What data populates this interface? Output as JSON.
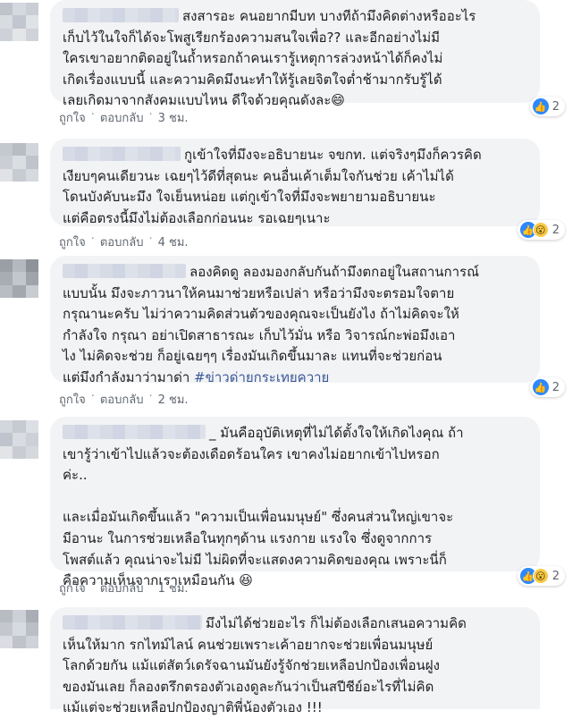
{
  "colors": {
    "bubble": "#f2f3f5",
    "like": "#2d88ff",
    "wow": "#f7c948",
    "hashtag": "#385898",
    "meta": "#606770"
  },
  "action_labels": {
    "like": "ถูกใจ",
    "reply": "ตอบกลับ",
    "dot": "·"
  },
  "comments": [
    {
      "text": "สงสารอะ คนอยากมีบท บางทีถ้ามึงคิดต่างหรืออะไร\nเก็บไว้ในใจก็ได้จะโพสูเรียกร้องความสนใจเพื่อ?? และอีกอย่างไม่มี\nใครเขาอยากติดอยู่ในถ้ำหรอกถ้าคนเรารู้เหตุการล่วงหน้าได้ก็คงไม่\nเกิดเรื่องแบบนี้ และความคิดมึงนะทำให้รู้เลยจิตใจต่ำช้ามากรับรู้ได้\nเลยเกิดมาจากสังคมแบบไหน ดีใจด้วยคุณดังละ😄",
      "time": "3 ชม.",
      "reaction_count": "2",
      "reaction_icons": [
        "like-icon"
      ]
    },
    {
      "text": "กูเข้าใจที่มึงจะอธิบายนะ จขกท. แต่จริงๆมึงก็ควรคิด\nเงียบๆคนเดียวนะ เฉยๆไว้ดีที่สุดนะ คนอื่นเค้าเต็มใจกันช่วย เค้าไม่ได้\nโดนบังคับนะมึง ใจเย็นหน่อย แต่กูเข้าใจที่มึงจะพยายามอธิบายนะ\nแต่คือตรงนี้มึงไม่ต้องเลือกก่อนนะ รอเฉยๆเนาะ",
      "time": "4 ชม.",
      "reaction_count": "2",
      "reaction_icons": [
        "like-icon",
        "wow-icon"
      ]
    },
    {
      "text": "ลองคิดดู ลองมองกลับกันถ้ามึงตกอยู่ในสถานการณ์\nแบบนั้น มึงจะภาวนาให้คนมาช่วยหรือเปล่า หรือว่ามึงจะตรอมใจตาย\nกรุณานะครับ ไม่ว่าความคิดส่วนตัวของคุณจะเป็นยังไง ถ้าไม่คิดจะให้\nกำลังใจ กรุณา อย่าเปิดสาธารณะ เก็บไว้มั่น หรือ วิจารณ์กะพ่อมึงเอา\nไง ไม่คิดจะช่วย ก็อยู่เฉยๆๆ เรื่องมันเกิดขึ้นมาละ แทนที่จะช่วยก่อน\nแต่มึงกำลังมาว่ามาด่า ",
      "hashtag": "#ข่าวด่ายกระเทยควาย",
      "time": "2 ชม.",
      "reaction_count": "2",
      "reaction_icons": [
        "like-icon"
      ]
    },
    {
      "text": "_ มันคืออุบัติเหตุที่ไม่ได้ตั้งใจให้เกิดไงคุณ ถ้า\nเขารู้ว่าเข้าไปแล้วจะต้องเดือดร้อนใคร เขาคงไม่อยากเข้าไปหรอก\nค่ะ..\n\nและเมื่อมันเกิดขึ้นแล้ว \"ความเป็นเพื่อนมนุษย์\" ซึ่งคนส่วนใหญ่เขาจะ\nมีอานะ ในการช่วยเหลือในทุกๆด้าน แรงกาย แรงใจ ซึ่งดูจากการ\nโพสต์แล้ว คุณน่าจะไม่มี ไม่ผิดที่จะแสดงความคิดของคุณ เพราะนี่ก็\nคือความเห็นจากเราเหมือนกัน 😆",
      "time": "1 ชม.",
      "reaction_count": "2",
      "reaction_icons": [
        "like-icon",
        "wow-icon"
      ]
    },
    {
      "text": "มึงไม่ได้ช่วยอะไร ก็ไม่ต้องเลือกเสนอความคิด\nเห็นให้มาก รกไทม์ไลน์ คนช่วยเพราะเค้าอยากจะช่วยเพื่อนมนุษย์\nโลกด้วยกัน แม้แต่สัตว์เดรัจฉานมันยังรู้จักช่วยเหลือปกป้องเพื่อนฝูง\nของมันเลย ก็ลองตรึกตรองตัวเองดูละกันว่าเป็นสปีชีย์อะไรที่ไม่คิด\nแม้แต่จะช่วยเหลือปกป้องญาติพี่น้องตัวเอง !!!"
    }
  ]
}
